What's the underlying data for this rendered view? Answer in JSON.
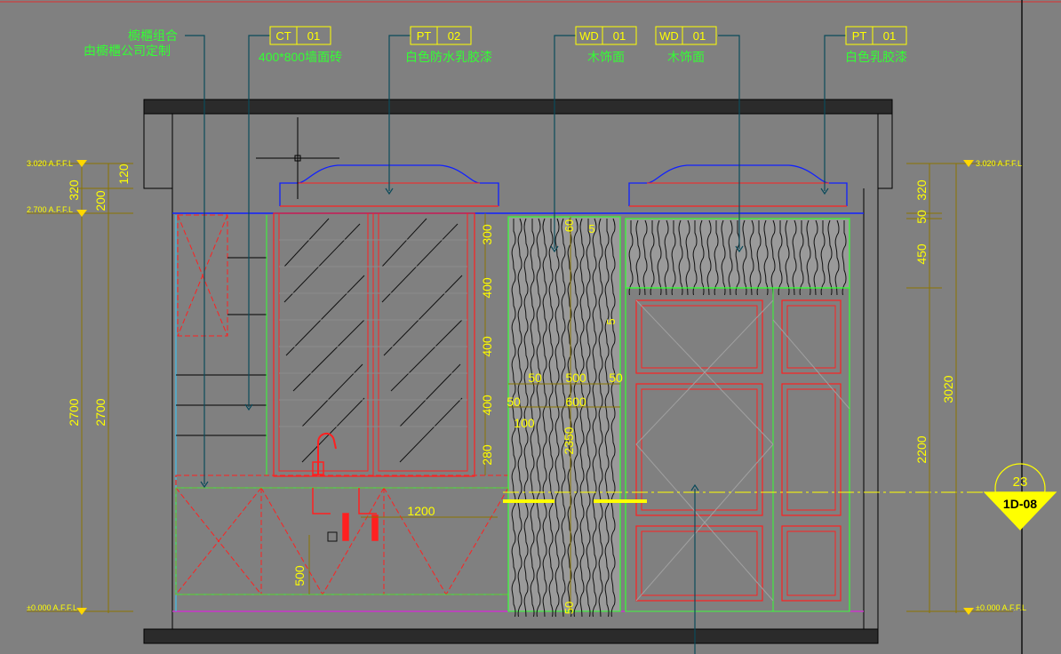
{
  "labels": {
    "cabinet_note_1": "櫥櫃组合",
    "cabinet_note_2": "由櫥櫃公司定制",
    "tag_ct": [
      "CT",
      "01"
    ],
    "tag_ct_desc": "400*800墙面砖",
    "tag_pt02": [
      "PT",
      "02"
    ],
    "tag_pt02_desc": "白色防水乳胶漆",
    "tag_wd1": [
      "WD",
      "01"
    ],
    "tag_wd1_desc": "木饰面",
    "tag_wd2": [
      "WD",
      "01"
    ],
    "tag_wd2_desc": "木饰面",
    "tag_pt01": [
      "PT",
      "01"
    ],
    "tag_pt01_desc": "白色乳胶漆",
    "level_top_left": "3.020 A.F.F.L",
    "level_mid_left": "2.700 A.F.F.L",
    "level_bot_left": "±0.000 A.F.F.L",
    "level_top_right": "3.020 A.F.F.L",
    "level_bot_right": "±0.000 A.F.F.L",
    "section_number": "23",
    "section_sheet": "1D-08"
  },
  "dims_left": {
    "d320": "320",
    "d120": "120",
    "d200": "200",
    "d2700a": "2700",
    "d2700b": "2700"
  },
  "dims_right": {
    "d320": "320",
    "d50": "50",
    "d450": "450",
    "d3020": "3020",
    "d2200": "2200"
  },
  "dims_center": {
    "d300": "300",
    "d400a": "400",
    "d400b": "400",
    "d400c": "400",
    "d280": "280",
    "d1200": "1200",
    "d500": "500",
    "d60": "60",
    "d5a": "5",
    "d5b": "5",
    "d50a": "50",
    "d500b": "500",
    "d50b": "50",
    "d50c": "50",
    "d600": "600",
    "d100": "100",
    "d2350": "2350",
    "d50d": "50"
  },
  "colors": {
    "background": "#808080",
    "text_green": "#33ff33",
    "dim_yellow": "#ffff00",
    "tag_yellow": "#ffff00",
    "leader": "#0a4a5a",
    "red_line": "#ff2020",
    "blue_line": "#1020ff",
    "slab": "#2b2b2b",
    "level_mark": "#ffd700"
  }
}
